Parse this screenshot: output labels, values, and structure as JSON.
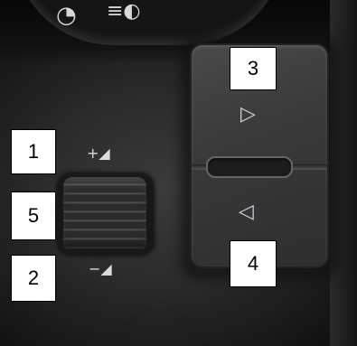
{
  "labels": {
    "one": "1",
    "two": "2",
    "three": "3",
    "four": "4",
    "five": "5"
  },
  "icons": {
    "volume_up": "volume-up-icon",
    "volume_down": "volume-down-icon",
    "next": "triangle-right-icon",
    "previous": "triangle-left-icon",
    "scroll_wheel": "thumb-wheel",
    "dash_gauge": "speedometer-icon",
    "dash_lights": "headlight-icon"
  }
}
